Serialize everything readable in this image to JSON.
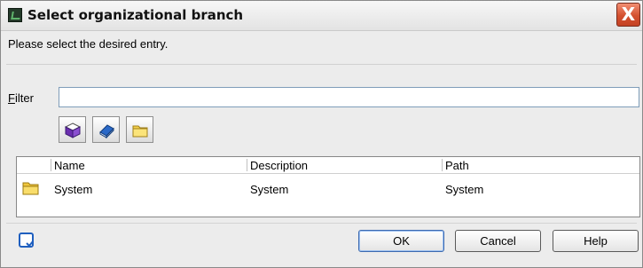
{
  "window": {
    "title": "Select organizational branch",
    "close_label": "X"
  },
  "prompt": "Please select the desired entry.",
  "filter": {
    "label_hotkey": "F",
    "label_rest": "ilter",
    "value": "",
    "placeholder": ""
  },
  "toolbar": [
    {
      "icon": "cube-icon"
    },
    {
      "icon": "book-icon"
    },
    {
      "icon": "folder-icon"
    }
  ],
  "table": {
    "columns": [
      "Name",
      "Description",
      "Path"
    ],
    "rows": [
      {
        "icon": "folder-icon",
        "name": "System",
        "description": "System",
        "path": "System"
      }
    ]
  },
  "buttons": {
    "ok": "OK",
    "cancel": "Cancel",
    "help": "Help"
  },
  "footer_icon": "checkbox-icon"
}
